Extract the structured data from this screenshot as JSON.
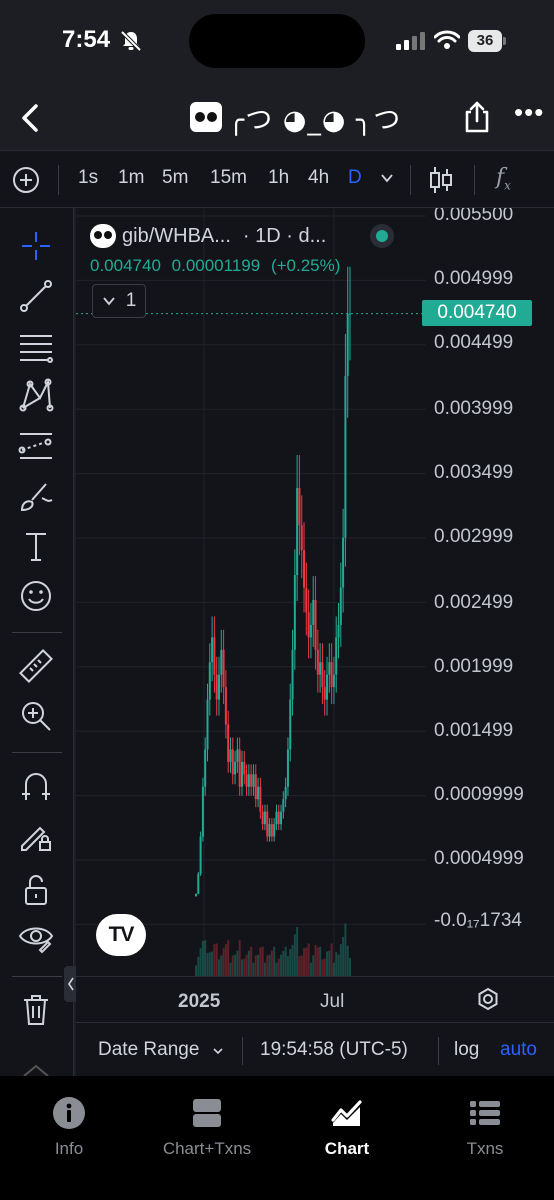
{
  "status_bar": {
    "time": "7:54",
    "battery": "36"
  },
  "header": {
    "title_kaomoji": "╭つ ◕_◕ ╮つ"
  },
  "intervals": [
    "1s",
    "1m",
    "5m",
    "15m",
    "1h",
    "4h",
    "D"
  ],
  "active_interval": "D",
  "legend": {
    "symbol": "gib/WHBA...",
    "interval_info": "· 1D · d...",
    "last": "0.004740",
    "change": "0.00001199",
    "change_pct": "(+0.25%)",
    "collapse_count": "1"
  },
  "price_axis": {
    "labels": [
      "0.005500",
      "0.004999",
      "0.004499",
      "0.003999",
      "0.003499",
      "0.002999",
      "0.002499",
      "0.001999",
      "0.001499",
      "0.0009999",
      "0.0004999"
    ],
    "negative_label": "-0.0₁₇1734",
    "last_price_tag": "0.004740"
  },
  "time_axis": {
    "labels": [
      "2025",
      "Jul"
    ]
  },
  "bottom_bar": {
    "date_range": "Date Range",
    "clock": "19:54:58 (UTC-5)",
    "log": "log",
    "auto": "auto"
  },
  "tabs": [
    {
      "label": "Info",
      "icon": "info-icon"
    },
    {
      "label": "Chart+Txns",
      "icon": "split-view-icon"
    },
    {
      "label": "Chart",
      "icon": "chart-icon"
    },
    {
      "label": "Txns",
      "icon": "list-icon"
    }
  ],
  "active_tab": "Chart",
  "colors": {
    "up": "#22ab94",
    "down": "#f23645",
    "accent": "#2962ff",
    "background": "#131419"
  },
  "chart_data": {
    "type": "line",
    "title": "",
    "xlabel": "",
    "ylabel": "",
    "x_ticks": [
      "2025",
      "Jul"
    ],
    "ylim": [
      -0.00017,
      0.0055
    ],
    "series": [
      {
        "values": [
          4e-05,
          0.0002,
          0.0005,
          0.0009,
          0.0012,
          0.0016,
          0.0019,
          0.0021,
          0.0018,
          0.0016,
          0.0018,
          0.002,
          0.0017,
          0.0014,
          0.0011,
          0.0012,
          0.001,
          0.0011,
          0.0012,
          0.0009,
          0.0011,
          0.001,
          0.0009,
          0.001,
          0.0009,
          0.001,
          0.0008,
          0.0009,
          0.0007,
          0.0006,
          0.0007,
          0.0005,
          0.0006,
          0.0005,
          0.0006,
          0.0007,
          0.0006,
          0.0007,
          0.0008,
          0.0009,
          0.0012,
          0.0016,
          0.002,
          0.0026,
          0.0033,
          0.003,
          0.0028,
          0.0025,
          0.0023,
          0.0021,
          0.0022,
          0.0024,
          0.002,
          0.0018,
          0.0019,
          0.0017,
          0.0016,
          0.0018,
          0.0019,
          0.0017,
          0.0018,
          0.0021,
          0.0022,
          0.0025,
          0.0029,
          0.0042,
          0.0047,
          0.0047
        ]
      }
    ]
  }
}
